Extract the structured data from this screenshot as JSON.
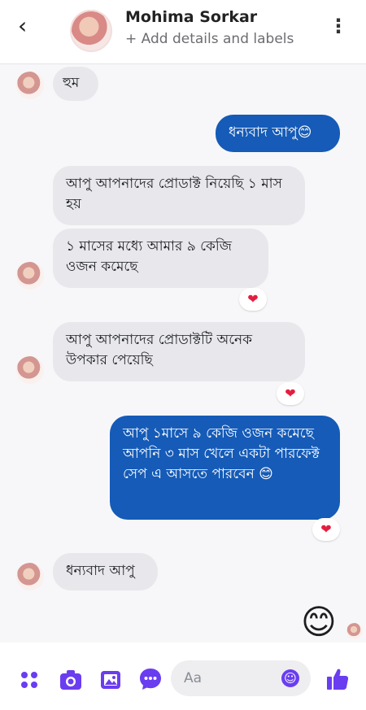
{
  "header": {
    "back_glyph": "‹",
    "name": "Mohima Sorkar",
    "subtitle": "+ Add details and labels",
    "menu_glyph": "⋮"
  },
  "messages": [
    {
      "text": "হুম"
    },
    {
      "text": "ধন্যবাদ আপু😊"
    },
    {
      "text": "আপু আপনাদের প্রোডাক্ট নিয়েছি ১ মাস হয়"
    },
    {
      "text": "১ মাসের মধ্যে আমার ৯ কেজি ওজন কমেছে"
    },
    {
      "text": "আপু আপনাদের প্রোডাক্টটি অনেক উপকার পেয়েছি"
    },
    {
      "text": "আপু ১মাসে ৯ কেজি ওজন কমেছে আপনি ৩ মাস খেলে একটা পারফেক্ট সেপ এ আসতে পারবেন 😊"
    },
    {
      "text": "ধন্যবাদ আপু"
    }
  ],
  "reactions": {
    "heart": "❤"
  },
  "big_emoji": "😊",
  "composer": {
    "placeholder": "Aa",
    "emoji_glyph": "☺"
  },
  "colors": {
    "accent": "#155bb7",
    "brand": "#6a3df0",
    "incoming_bubble": "#e8e8ec"
  },
  "icons": [
    "back-icon",
    "menu-icon",
    "apps-icon",
    "camera-icon",
    "gallery-icon",
    "chat-icon",
    "emoji-icon",
    "like-icon"
  ]
}
